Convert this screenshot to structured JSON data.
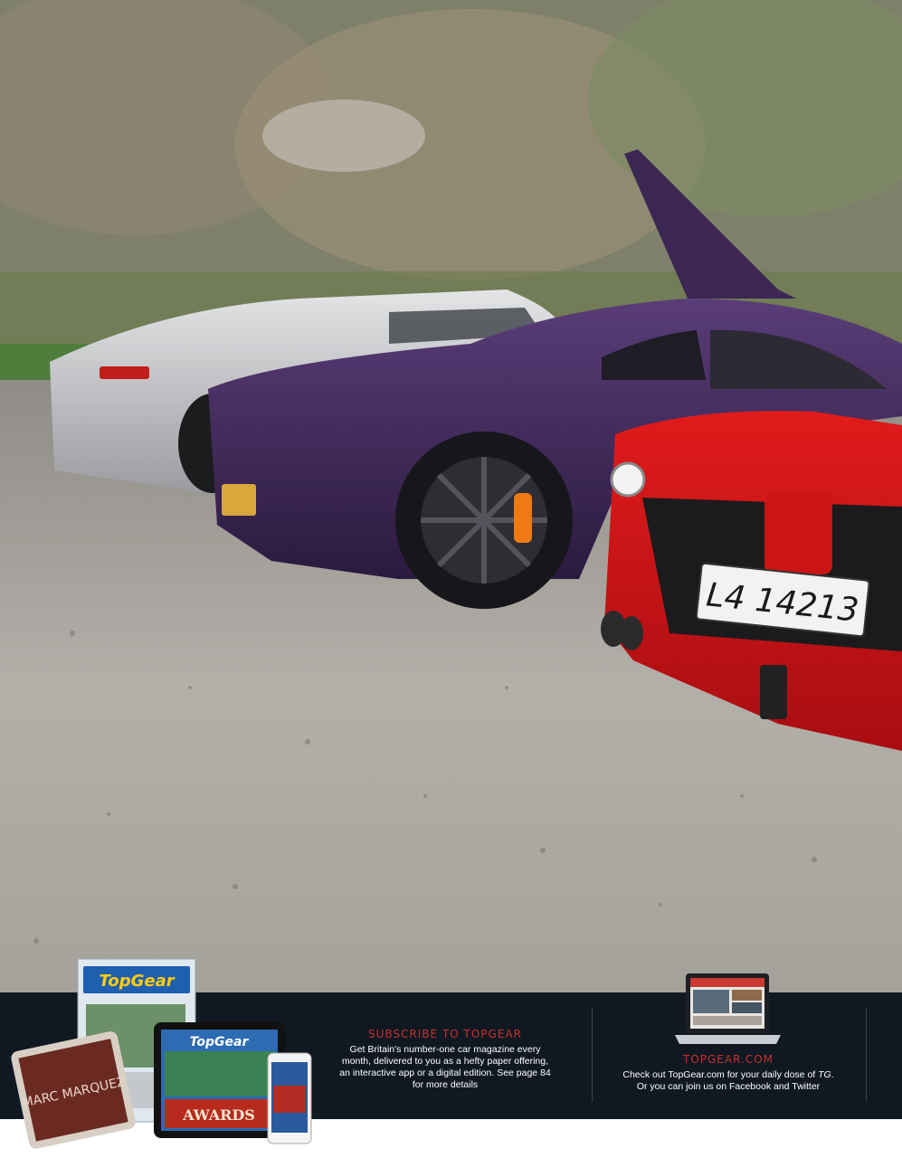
{
  "photo": {
    "description_icon": "car-photo",
    "plate_text": "L4 14213"
  },
  "subscribe": {
    "title": "SUBSCRIBE TO TOPGEAR",
    "body": "Get Britain's number-one car magazine every month, delivered to you as a hefty paper offering, an interactive app or a digital edition. See page 84 for more details"
  },
  "website": {
    "title": "TOPGEAR.COM",
    "body_line1_prefix": "Check out TopGear.com for your daily dose of ",
    "body_line1_em": "TG",
    "body_line1_suffix": ".",
    "body_line2": "Or you can join us on Facebook and Twitter"
  },
  "devices": {
    "magazine_logo": "TopGear",
    "tablet_logo": "TopGear",
    "awards_text": "AWARDS",
    "tablet_cover_text": "MARC MARQUEZ"
  },
  "colors": {
    "footer_bg": "#101822",
    "accent_red": "#c9302c"
  }
}
